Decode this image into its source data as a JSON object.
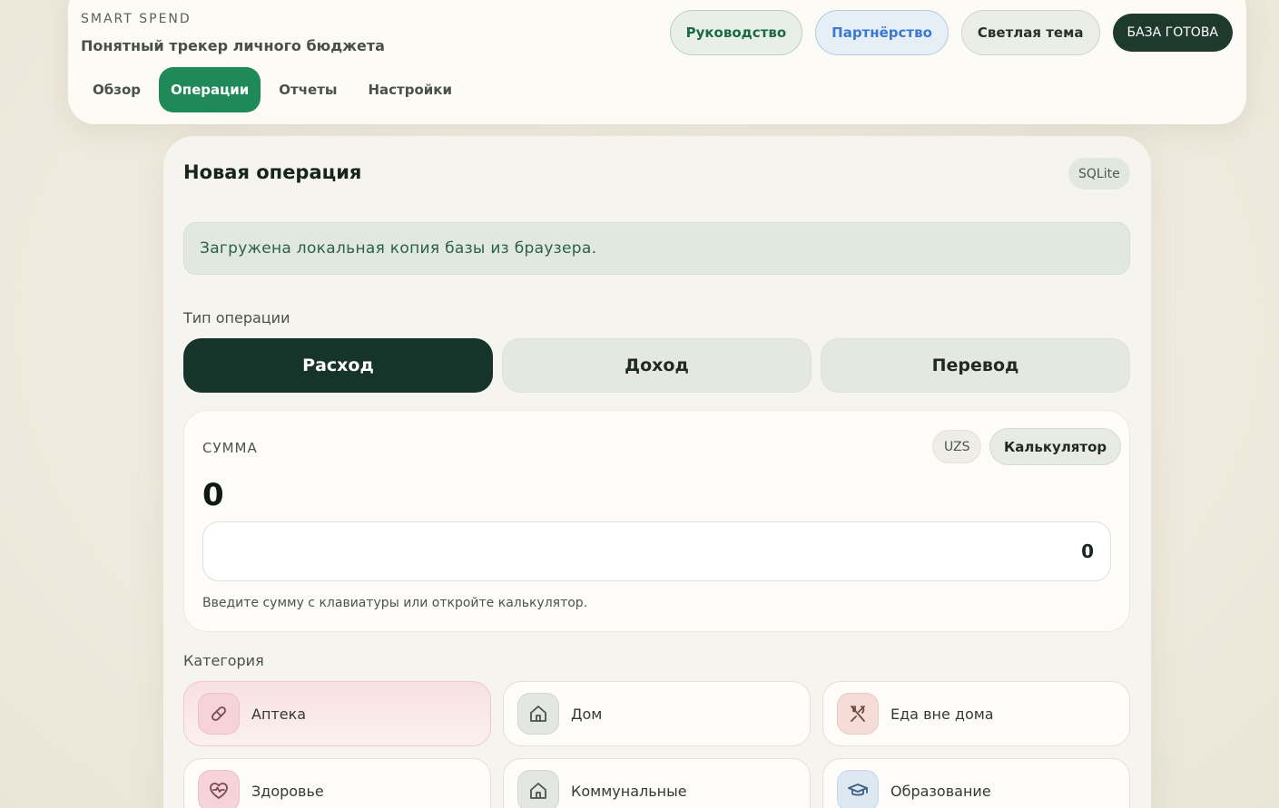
{
  "app": {
    "brand": "SMART SPEND",
    "tagline": "Понятный трекер личного бюджета"
  },
  "nav": {
    "items": [
      {
        "label": "Обзор",
        "active": false
      },
      {
        "label": "Операции",
        "active": true
      },
      {
        "label": "Отчеты",
        "active": false
      },
      {
        "label": "Настройки",
        "active": false
      }
    ]
  },
  "top_actions": {
    "guide": "Руководство",
    "partner": "Партнёрство",
    "theme": "Светлая тема",
    "db_status": "БАЗА ГОТОВА"
  },
  "form": {
    "title": "Новая операция",
    "storage_badge": "SQLite",
    "notice": "Загружена локальная копия базы из браузера.",
    "type_label": "Тип операции",
    "types": [
      {
        "label": "Расход",
        "active": true
      },
      {
        "label": "Доход",
        "active": false
      },
      {
        "label": "Перевод",
        "active": false
      }
    ],
    "amount": {
      "label": "СУММА",
      "currency": "UZS",
      "calculator_button": "Калькулятор",
      "display_value": "0",
      "input_value": "0",
      "hint": "Введите сумму с клавиатуры или откройте калькулятор."
    },
    "category_label": "Категория",
    "categories": [
      {
        "label": "Аптека",
        "icon": "pill-icon",
        "active": true
      },
      {
        "label": "Дом",
        "icon": "home-icon",
        "active": false
      },
      {
        "label": "Еда вне дома",
        "icon": "utensils-icon",
        "active": false
      },
      {
        "label": "Здоровье",
        "icon": "heart-pulse-icon",
        "active": false
      },
      {
        "label": "Коммунальные",
        "icon": "home-icon",
        "active": false
      },
      {
        "label": "Образование",
        "icon": "graduation-cap-icon",
        "active": false
      }
    ]
  },
  "colors": {
    "accent_green": "#1f8a57",
    "dark_green": "#17342a",
    "partner_blue": "#3c78d2"
  }
}
